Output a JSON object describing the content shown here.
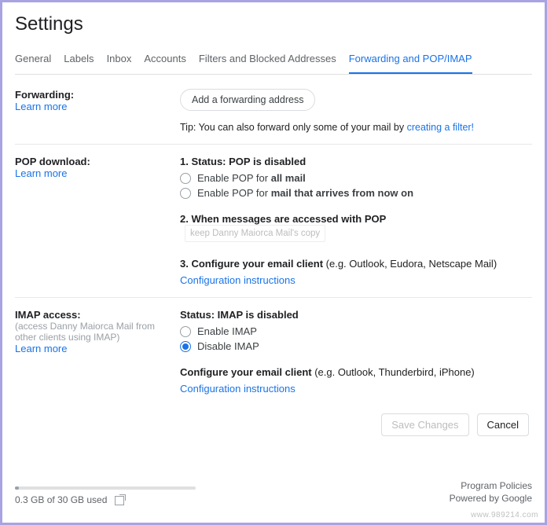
{
  "title": "Settings",
  "tabs": {
    "general": "General",
    "labels": "Labels",
    "inbox": "Inbox",
    "accounts": "Accounts",
    "filters": "Filters and Blocked Addresses",
    "forwarding": "Forwarding and POP/IMAP"
  },
  "forwarding": {
    "heading": "Forwarding:",
    "learn_more": "Learn more",
    "add_button": "Add a forwarding address",
    "tip_prefix": "Tip: You can also forward only some of your mail by ",
    "tip_link": "creating a filter!"
  },
  "pop": {
    "heading": "POP download:",
    "learn_more": "Learn more",
    "status_num": "1. Status: ",
    "status_val": "POP is disabled",
    "opt1_prefix": "Enable POP for ",
    "opt1_bold": "all mail",
    "opt2_prefix": "Enable POP for ",
    "opt2_bold": "mail that arrives from now on",
    "step2_label": "2. When messages are accessed with POP",
    "step2_dropdown": "keep Danny Maiorca Mail's copy",
    "step3_bold": "3. Configure your email client",
    "step3_rest": " (e.g. Outlook, Eudora, Netscape Mail)",
    "config_link": "Configuration instructions"
  },
  "imap": {
    "heading": "IMAP access:",
    "sub": "(access Danny Maiorca Mail from other clients using IMAP)",
    "learn_more": "Learn more",
    "status_label": "Status: ",
    "status_val": "IMAP is disabled",
    "enable": "Enable IMAP",
    "disable": "Disable IMAP",
    "conf_bold": "Configure your email client",
    "conf_rest": " (e.g. Outlook, Thunderbird, iPhone)",
    "config_link": "Configuration instructions"
  },
  "actions": {
    "save": "Save Changes",
    "cancel": "Cancel"
  },
  "footer": {
    "storage": "0.3 GB of 30 GB used",
    "policies": "Program Policies",
    "powered": "Powered by Google"
  },
  "watermark": "www.989214.com"
}
